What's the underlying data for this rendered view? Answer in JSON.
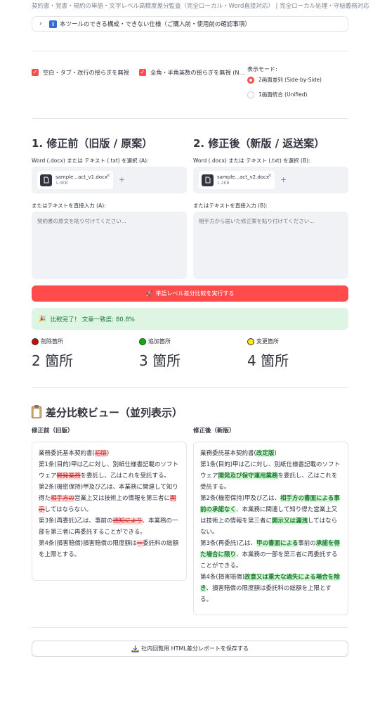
{
  "topbar": {
    "text": "契約書・覚書・規約の単語・文字レベル高精度差分監査（完全ローカル・Word直接対応） | 完全ローカル処理・守秘義務対応"
  },
  "expander": {
    "label": "本ツールのできる構成・できない仕様（ご購入前・使用前の確認事項）"
  },
  "options": {
    "ignore_whitespace": "空白・タブ・改行の揺らぎを無視",
    "ignore_width": "全角・半角英数の揺らぎを無視 (N...",
    "display_mode_label": "表示モード:",
    "mode_side": "2画面並列 (Side-by-Side)",
    "mode_unified": "1画面統合 (Unified)"
  },
  "before": {
    "heading": "1. 修正前（旧版 / 原案）",
    "upload_label": "Word (.docx) または テキスト (.txt) を選択 (A):",
    "file_name": "sample...act_v1.docx",
    "file_size": "1.0KB",
    "text_label": "またはテキストを直接入力 (A):",
    "placeholder": "契約書の原文を貼り付けてください..."
  },
  "after": {
    "heading": "2. 修正後（新版 / 返送案）",
    "upload_label": "Word (.docx) または テキスト (.txt) を選択 (B):",
    "file_name": "sample...act_v2.docx",
    "file_size": "1.2KB",
    "text_label": "またはテキストを直接入力 (B):",
    "placeholder": "相手方から届いた修正案を貼り付けてください..."
  },
  "run_button": "単語レベル差分比較を実行する",
  "success": "比較完了！ 文章一致度: 80.8%",
  "metrics": [
    {
      "label": "削除箇所",
      "value": "2 箇所",
      "color": "#d90000"
    },
    {
      "label": "追加箇所",
      "value": "3 箇所",
      "color": "#00b300"
    },
    {
      "label": "変更箇所",
      "value": "4 箇所",
      "color": "#ffea00"
    }
  ],
  "diff": {
    "heading": "差分比較ビュー（並列表示）",
    "left_head": "修正前（旧版）",
    "right_head": "修正後（新版）",
    "left": {
      "p1a": "業務委託基本契約書(",
      "p1d": "初版",
      "p1b": ")",
      "p2a": "第1条(目的)甲は乙に対し、別紙仕様書記載のソフトウェア",
      "p2d": "開発業務",
      "p2b": "を委託し、乙はこれを受託する。",
      "p3a": "第2条(機密保持)甲及び乙は、本業務に関連して知り得た",
      "p3d": "相手方の",
      "p3b": "営業上又は技術上の情報を第三者に",
      "p3d2": "開示",
      "p3c": "してはならない。",
      "p4a": "第3条(再委託)乙は、事前の",
      "p4d": "通知により",
      "p4b": "、本業務の一部を第三者に再委託することができる。",
      "p5a": "第4条(損害賠償)損害賠償の限度額は",
      "p5d": "一",
      "p5b": "委託料の総額を上限とする。"
    },
    "right": {
      "p1a": "業務委託基本契約書(",
      "p1i": "改定版",
      "p1b": ")",
      "p2a": "第1条(目的)甲は乙に対し、別紙仕様書記載のソフトウェア",
      "p2i": "開発及び保守運用業務",
      "p2b": "を委託し、乙はこれを受託する。",
      "p3a": "第2条(機密保持)甲及び乙は、",
      "p3i": "相手方の書面による事前の承諾なく",
      "p3b": "、本業務に関連して知り得た営業上又は技術上の情報を第三者に",
      "p3i2": "開示又は漏洩",
      "p3c": "してはならない。",
      "p4a": "第3条(再委託)乙は、",
      "p4i": "甲の書面による",
      "p4b": "事前の",
      "p4i2": "承諾を得た場合に限り",
      "p4c": "、本業務の一部を第三者に再委託することができる。",
      "p5a": "第4条(損害賠償)",
      "p5i": "故意又は重大な過失による場合を除き",
      "p5b": "、損害賠償の限度額は委託料の総額を上限とする。"
    }
  },
  "save_button": "社内回覧用 HTML差分レポートを保存する",
  "colors": {
    "accent": "#ff4b4b",
    "success_bg": "#dff5e3",
    "success_text": "#177233"
  }
}
